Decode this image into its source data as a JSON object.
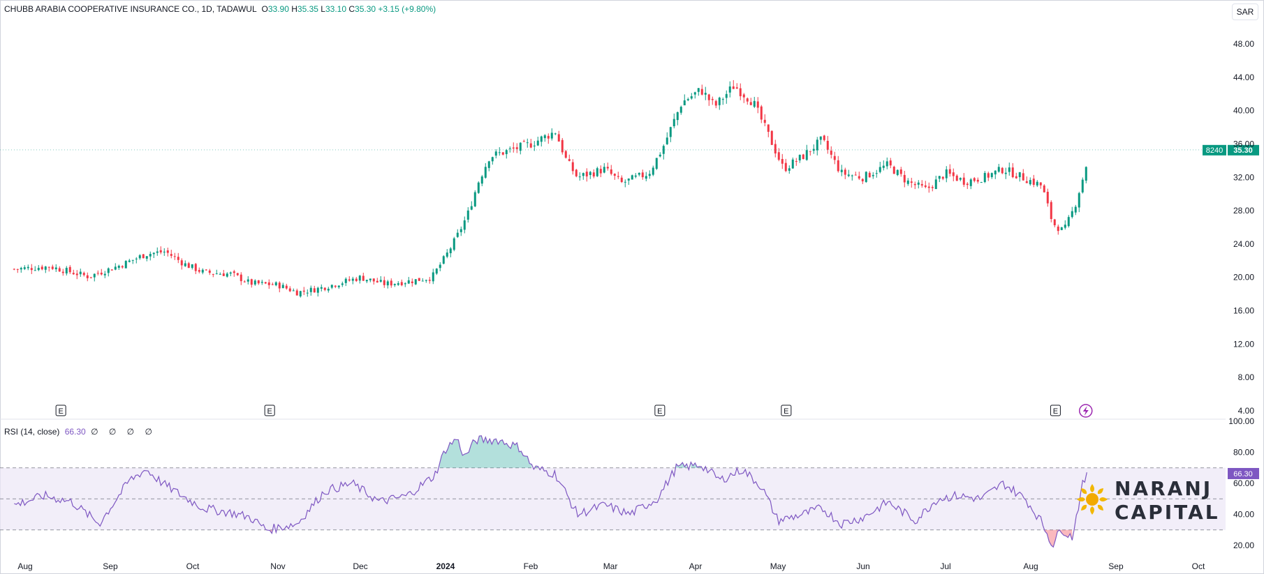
{
  "header": {
    "symbol": "CHUBB ARABIA COOPERATIVE INSURANCE CO., 1D, TADAWUL",
    "open_label": "O",
    "open": "33.90",
    "high_label": "H",
    "high": "35.35",
    "low_label": "L",
    "low": "33.10",
    "close_label": "C",
    "close": "35.30",
    "change": "+3.15 (+9.80%)"
  },
  "currency_label": "SAR",
  "rsi": {
    "legend": "RSI (14, close)",
    "value": "66.30",
    "empty_values": "∅ ∅ ∅ ∅",
    "badge": "66.30"
  },
  "price_badge": {
    "volume": "8240",
    "price": "35.30"
  },
  "event_markers": [
    "E",
    "E",
    "E",
    "E",
    "E"
  ],
  "logo": {
    "line1": "NARANJ",
    "line2": "CAPITAL"
  },
  "colors": {
    "up": "#089981",
    "down": "#f23645",
    "rsi": "#7e57c2",
    "rsi_band": "#ede7f6",
    "overbought": "#26a69a",
    "oversold": "#f23645"
  },
  "chart_data": [
    {
      "type": "candlestick",
      "title": "CHUBB ARABIA COOPERATIVE INSURANCE CO., 1D, TADAWUL",
      "x_ticks": [
        "Aug",
        "Sep",
        "Oct",
        "Nov",
        "Dec",
        "2024",
        "Feb",
        "Mar",
        "Apr",
        "May",
        "Jun",
        "Jul",
        "Aug",
        "Sep",
        "Oct"
      ],
      "y_ticks": [
        "48.00",
        "44.00",
        "40.00",
        "36.00",
        "32.00",
        "28.00",
        "24.00",
        "20.00",
        "16.00",
        "12.00",
        "8.00",
        "4.00"
      ],
      "ylim": [
        4,
        50
      ],
      "close_series": [
        {
          "date": "2023-07-28",
          "close": 21.0
        },
        {
          "date": "2023-08-10",
          "close": 21.3
        },
        {
          "date": "2023-08-24",
          "close": 20.1
        },
        {
          "date": "2023-09-05",
          "close": 21.5
        },
        {
          "date": "2023-09-14",
          "close": 22.8
        },
        {
          "date": "2023-09-21",
          "close": 23.1
        },
        {
          "date": "2023-09-28",
          "close": 21.6
        },
        {
          "date": "2023-10-05",
          "close": 20.6
        },
        {
          "date": "2023-10-15",
          "close": 20.4
        },
        {
          "date": "2023-10-22",
          "close": 19.3
        },
        {
          "date": "2023-11-01",
          "close": 19.1
        },
        {
          "date": "2023-11-08",
          "close": 18.2
        },
        {
          "date": "2023-11-15",
          "close": 18.6
        },
        {
          "date": "2023-11-22",
          "close": 19.2
        },
        {
          "date": "2023-12-01",
          "close": 20.0
        },
        {
          "date": "2023-12-10",
          "close": 19.2
        },
        {
          "date": "2023-12-20",
          "close": 19.6
        },
        {
          "date": "2023-12-27",
          "close": 20.0
        },
        {
          "date": "2024-01-01",
          "close": 22.5
        },
        {
          "date": "2024-01-05",
          "close": 24.8
        },
        {
          "date": "2024-01-09",
          "close": 27.5
        },
        {
          "date": "2024-01-13",
          "close": 31.5
        },
        {
          "date": "2024-01-17",
          "close": 34.5
        },
        {
          "date": "2024-01-24",
          "close": 35.2
        },
        {
          "date": "2024-02-01",
          "close": 36.0
        },
        {
          "date": "2024-02-10",
          "close": 37.5
        },
        {
          "date": "2024-02-14",
          "close": 34.0
        },
        {
          "date": "2024-02-18",
          "close": 32.0
        },
        {
          "date": "2024-02-28",
          "close": 33.0
        },
        {
          "date": "2024-03-05",
          "close": 31.3
        },
        {
          "date": "2024-03-15",
          "close": 32.5
        },
        {
          "date": "2024-03-20",
          "close": 35.5
        },
        {
          "date": "2024-03-27",
          "close": 41.0
        },
        {
          "date": "2024-04-03",
          "close": 42.5
        },
        {
          "date": "2024-04-08",
          "close": 40.5
        },
        {
          "date": "2024-04-15",
          "close": 43.0
        },
        {
          "date": "2024-04-22",
          "close": 41.0
        },
        {
          "date": "2024-04-29",
          "close": 36.0
        },
        {
          "date": "2024-05-03",
          "close": 33.0
        },
        {
          "date": "2024-05-10",
          "close": 34.5
        },
        {
          "date": "2024-05-17",
          "close": 36.5
        },
        {
          "date": "2024-05-24",
          "close": 32.5
        },
        {
          "date": "2024-06-01",
          "close": 32.0
        },
        {
          "date": "2024-06-10",
          "close": 33.5
        },
        {
          "date": "2024-06-17",
          "close": 31.5
        },
        {
          "date": "2024-06-24",
          "close": 30.5
        },
        {
          "date": "2024-07-01",
          "close": 32.5
        },
        {
          "date": "2024-07-08",
          "close": 31.5
        },
        {
          "date": "2024-07-15",
          "close": 32.0
        },
        {
          "date": "2024-07-22",
          "close": 33.0
        },
        {
          "date": "2024-07-29",
          "close": 32.0
        },
        {
          "date": "2024-08-05",
          "close": 31.0
        },
        {
          "date": "2024-08-09",
          "close": 26.5
        },
        {
          "date": "2024-08-13",
          "close": 25.5
        },
        {
          "date": "2024-08-17",
          "close": 28.5
        },
        {
          "date": "2024-08-21",
          "close": 33.1
        },
        {
          "date": "2024-08-22",
          "close": 35.3
        }
      ],
      "last_price": 35.3
    },
    {
      "type": "line",
      "title": "RSI (14, close)",
      "y_ticks": [
        "100.00",
        "80.00",
        "60.00",
        "40.00",
        "20.00"
      ],
      "ylim": [
        15,
        101
      ],
      "bands": [
        30,
        70
      ],
      "rsi_series": [
        {
          "date": "2023-07-28",
          "rsi": 46
        },
        {
          "date": "2023-08-08",
          "rsi": 52
        },
        {
          "date": "2023-08-18",
          "rsi": 48
        },
        {
          "date": "2023-08-28",
          "rsi": 34
        },
        {
          "date": "2023-09-08",
          "rsi": 62
        },
        {
          "date": "2023-09-14",
          "rsi": 69
        },
        {
          "date": "2023-09-20",
          "rsi": 60
        },
        {
          "date": "2023-09-28",
          "rsi": 51
        },
        {
          "date": "2023-10-05",
          "rsi": 44
        },
        {
          "date": "2023-10-15",
          "rsi": 41
        },
        {
          "date": "2023-10-22",
          "rsi": 38
        },
        {
          "date": "2023-10-28",
          "rsi": 30
        },
        {
          "date": "2023-11-08",
          "rsi": 34
        },
        {
          "date": "2023-11-18",
          "rsi": 55
        },
        {
          "date": "2023-11-28",
          "rsi": 60
        },
        {
          "date": "2023-12-08",
          "rsi": 48
        },
        {
          "date": "2023-12-18",
          "rsi": 52
        },
        {
          "date": "2023-12-28",
          "rsi": 65
        },
        {
          "date": "2024-01-01",
          "rsi": 82
        },
        {
          "date": "2024-01-05",
          "rsi": 89
        },
        {
          "date": "2024-01-08",
          "rsi": 77
        },
        {
          "date": "2024-01-12",
          "rsi": 88
        },
        {
          "date": "2024-01-20",
          "rsi": 88
        },
        {
          "date": "2024-01-28",
          "rsi": 83
        },
        {
          "date": "2024-02-02",
          "rsi": 70
        },
        {
          "date": "2024-02-10",
          "rsi": 66
        },
        {
          "date": "2024-02-18",
          "rsi": 40
        },
        {
          "date": "2024-02-28",
          "rsi": 46
        },
        {
          "date": "2024-03-08",
          "rsi": 40
        },
        {
          "date": "2024-03-18",
          "rsi": 50
        },
        {
          "date": "2024-03-25",
          "rsi": 70
        },
        {
          "date": "2024-04-03",
          "rsi": 72
        },
        {
          "date": "2024-04-10",
          "rsi": 62
        },
        {
          "date": "2024-04-18",
          "rsi": 69
        },
        {
          "date": "2024-04-25",
          "rsi": 58
        },
        {
          "date": "2024-05-01",
          "rsi": 36
        },
        {
          "date": "2024-05-10",
          "rsi": 40
        },
        {
          "date": "2024-05-17",
          "rsi": 44
        },
        {
          "date": "2024-05-24",
          "rsi": 34
        },
        {
          "date": "2024-06-01",
          "rsi": 38
        },
        {
          "date": "2024-06-10",
          "rsi": 48
        },
        {
          "date": "2024-06-20",
          "rsi": 36
        },
        {
          "date": "2024-06-28",
          "rsi": 50
        },
        {
          "date": "2024-07-05",
          "rsi": 52
        },
        {
          "date": "2024-07-14",
          "rsi": 50
        },
        {
          "date": "2024-07-22",
          "rsi": 60
        },
        {
          "date": "2024-07-30",
          "rsi": 50
        },
        {
          "date": "2024-08-05",
          "rsi": 35
        },
        {
          "date": "2024-08-09",
          "rsi": 20
        },
        {
          "date": "2024-08-12",
          "rsi": 31
        },
        {
          "date": "2024-08-16",
          "rsi": 25
        },
        {
          "date": "2024-08-20",
          "rsi": 60
        },
        {
          "date": "2024-08-22",
          "rsi": 66.3
        }
      ]
    }
  ]
}
